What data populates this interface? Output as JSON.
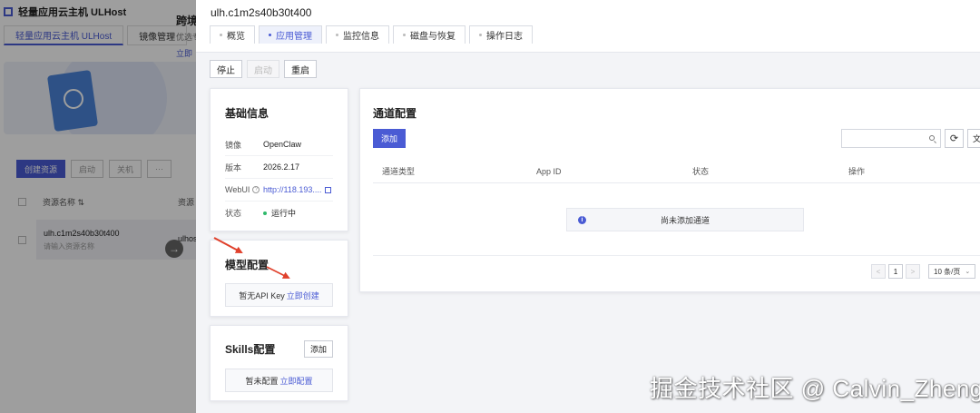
{
  "background": {
    "app_title": "轻量应用云主机 ULHost",
    "tabs": [
      {
        "label": "轻量应用云主机 ULHost"
      },
      {
        "label": "镜像管理"
      }
    ],
    "banner": {
      "heading": "跨境",
      "sub": "优选专",
      "link": "立即"
    },
    "actions": [
      {
        "label": "创建资源"
      },
      {
        "label": "启动"
      },
      {
        "label": "关机"
      },
      {
        "label": "···"
      }
    ],
    "table": {
      "header_name": "资源名称 ⇅",
      "header_resource": "资源",
      "row_name": "ulh.c1m2s40b30t400",
      "row_sub": "请输入资源名称",
      "row_host": "ulhos"
    }
  },
  "drawer": {
    "title": "ulh.c1m2s40b30t400",
    "tabs": [
      {
        "label": "概览",
        "active": false
      },
      {
        "label": "应用管理",
        "active": true
      },
      {
        "label": "监控信息",
        "active": false
      },
      {
        "label": "磁盘与恢复",
        "active": false
      },
      {
        "label": "操作日志",
        "active": false
      }
    ],
    "toolbar": {
      "stop": "停止",
      "start": "启动",
      "restart": "重启"
    },
    "basic": {
      "title": "基础信息",
      "image_label": "镜像",
      "image_value": "OpenClaw",
      "version_label": "版本",
      "version_value": "2026.2.17",
      "webui_label": "WebUI",
      "webui_value": "http://118.193....",
      "status_label": "状态",
      "status_value": "运行中",
      "status_color": "#2fb96b"
    },
    "model": {
      "title": "模型配置",
      "empty_text": "暂无API Key",
      "empty_link": "立即创建"
    },
    "skills": {
      "title": "Skills配置",
      "add": "添加",
      "empty_text": "暂未配置",
      "empty_link": "立即配置"
    },
    "channel": {
      "title": "通道配置",
      "add": "添加",
      "search_placeholder": "",
      "doc_button": "文",
      "columns": [
        "通道类型",
        "App ID",
        "状态",
        "操作"
      ],
      "empty_text": "尚未添加通道",
      "pagination": {
        "prev": "<",
        "current": "1",
        "next": ">",
        "page_size": "10 条/页"
      }
    }
  },
  "colors": {
    "accent": "#4a5bd4",
    "annotation": "#e0402b"
  },
  "watermark": "掘金技术社区 @ Calvin_Zheng"
}
